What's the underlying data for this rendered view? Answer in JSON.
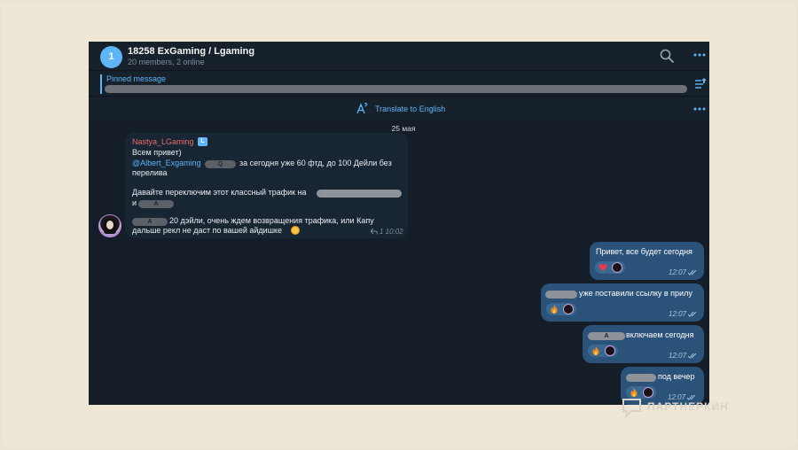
{
  "header": {
    "avatar_letter": "1",
    "title": "18258 ExGaming / Lgaming",
    "subtitle": "20 members, 2 online"
  },
  "pinned": {
    "label": "Pinned message"
  },
  "translate": {
    "label": "Translate to English"
  },
  "date_separator": "25 мая",
  "incoming": {
    "sender": "Nastya_LGaming",
    "sender_badge": "L",
    "line1": "Всем привет)",
    "mention": "@Albert_Exgaming",
    "blur1": "Q",
    "line2_rest": "за сегодня уже 60 фтд, до 100 Дейли без",
    "line3": "перелива",
    "line4": "Давайте переключим этот классный трафик на",
    "line5_prefix": "и",
    "blur2": "A",
    "blur3": "A",
    "line6_rest": "20 дэйли, очень ждем возвращения трафика, или Капу",
    "line7": "дальше рекл не даст по вашей айдишке",
    "meta": "1 10:02"
  },
  "outgoing": [
    {
      "text": "Привет, все будет сегодня",
      "time": "12:07",
      "reaction": "heart"
    },
    {
      "text": "уже поставили ссылку в прилу",
      "time": "12:07",
      "reaction": "fire"
    },
    {
      "blur": "A",
      "text": "включаем сегодня",
      "time": "12:07",
      "reaction": "fire"
    },
    {
      "text": "под вечер",
      "time": "12:07",
      "reaction": "fire"
    }
  ],
  "watermark": "ПАРТНЕРКИН",
  "colors": {
    "accent": "#5eb5f7",
    "bubble_out": "#2b5278",
    "bubble_in": "#182533",
    "sender_name": "#e96c6c"
  }
}
